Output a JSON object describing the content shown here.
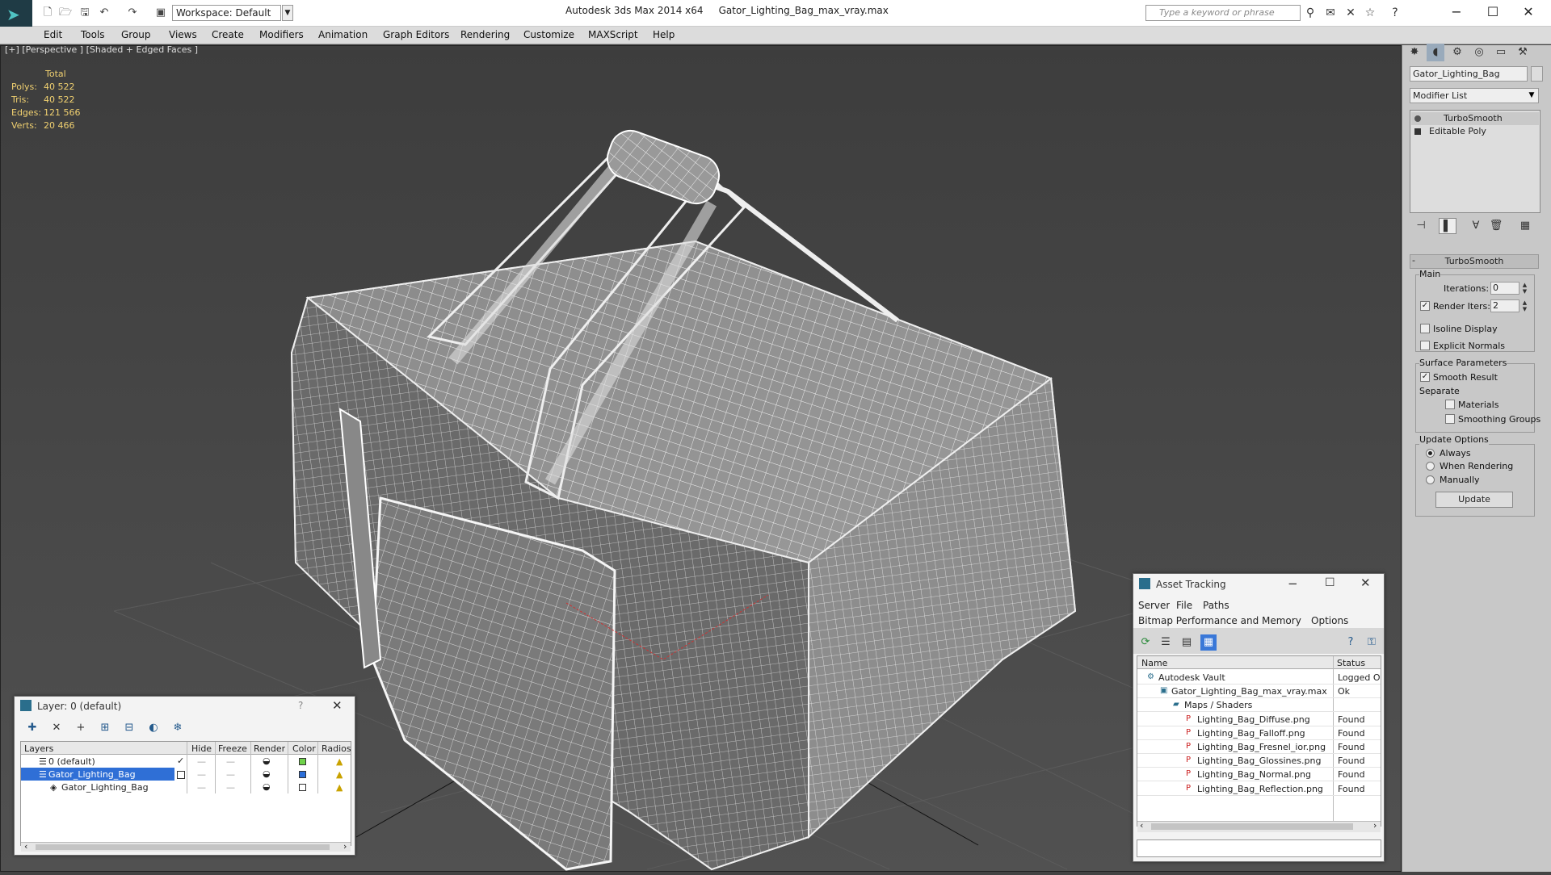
{
  "app": {
    "title": "Autodesk 3ds Max  2014 x64",
    "file": "Gator_Lighting_Bag_max_vray.max",
    "workspace": "Workspace: Default",
    "search_placeholder": "Type a keyword or phrase"
  },
  "menu": [
    "Edit",
    "Tools",
    "Group",
    "Views",
    "Create",
    "Modifiers",
    "Animation",
    "Graph Editors",
    "Rendering",
    "Customize",
    "MAXScript",
    "Help"
  ],
  "viewport": {
    "label": "[+] [Perspective ] [Shaded + Edged Faces ]",
    "stats_header": "Total",
    "stats": [
      {
        "key": "Polys:",
        "value": "40 522"
      },
      {
        "key": "Tris:",
        "value": "40 522"
      },
      {
        "key": "Edges:",
        "value": "121 566"
      },
      {
        "key": "Verts:",
        "value": "20 466"
      }
    ]
  },
  "command_panel": {
    "object_name": "Gator_Lighting_Bag",
    "modifier_list": "Modifier List",
    "stack": [
      "TurboSmooth",
      "Editable Poly"
    ],
    "rollout_title": "TurboSmooth",
    "main_group": "Main",
    "iterations_label": "Iterations:",
    "iterations_value": "0",
    "render_iters_label": "Render Iters:",
    "render_iters_value": "2",
    "isoline_label": "Isoline Display",
    "explicit_normals_label": "Explicit Normals",
    "surface_params_label": "Surface Parameters",
    "smooth_result_label": "Smooth Result",
    "separate_label": "Separate",
    "materials_label": "Materials",
    "smoothing_groups_label": "Smoothing Groups",
    "update_options_label": "Update Options",
    "always_label": "Always",
    "when_rendering_label": "When Rendering",
    "manually_label": "Manually",
    "update_button": "Update"
  },
  "layer_dialog": {
    "title": "Layer: 0 (default)",
    "help": "?",
    "columns": [
      "Layers",
      "Hide",
      "Freeze",
      "Render",
      "Color",
      "Radiosi"
    ],
    "rows": [
      {
        "name": "0 (default)",
        "color": "#6fd24a"
      },
      {
        "name": "Gator_Lighting_Bag",
        "color": "#2a6ed8"
      },
      {
        "name": "Gator_Lighting_Bag",
        "color": "#ffffff"
      }
    ]
  },
  "asset_tracking": {
    "title": "Asset Tracking",
    "menus": [
      "Server",
      "File",
      "Paths"
    ],
    "menus2": [
      "Bitmap Performance and Memory",
      "Options"
    ],
    "columns": [
      "Name",
      "Status"
    ],
    "rows": [
      {
        "name": "Autodesk Vault",
        "status": "Logged O"
      },
      {
        "name": "Gator_Lighting_Bag_max_vray.max",
        "status": "Ok"
      },
      {
        "name": "Maps / Shaders",
        "status": ""
      },
      {
        "name": "Lighting_Bag_Diffuse.png",
        "status": "Found"
      },
      {
        "name": "Lighting_Bag_Falloff.png",
        "status": "Found"
      },
      {
        "name": "Lighting_Bag_Fresnel_ior.png",
        "status": "Found"
      },
      {
        "name": "Lighting_Bag_Glossines.png",
        "status": "Found"
      },
      {
        "name": "Lighting_Bag_Normal.png",
        "status": "Found"
      },
      {
        "name": "Lighting_Bag_Reflection.png",
        "status": "Found"
      }
    ]
  },
  "icons": {
    "folder": "📁",
    "png": "PNG"
  }
}
